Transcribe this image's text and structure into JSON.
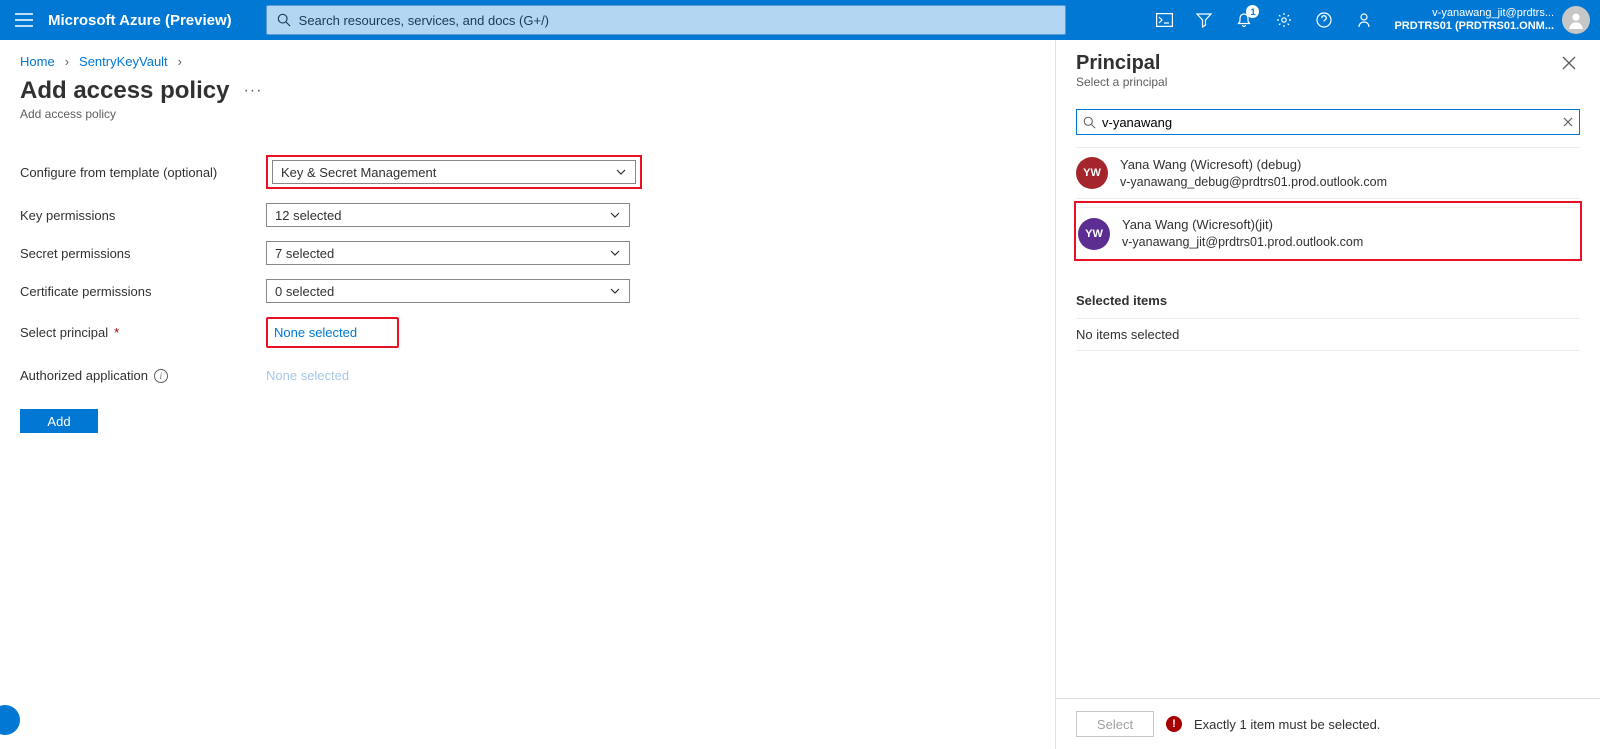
{
  "header": {
    "brand": "Microsoft Azure (Preview)",
    "search_placeholder": "Search resources, services, and docs (G+/)",
    "notifications_badge": "1",
    "user_line1": "v-yanawang_jit@prdtrs...",
    "user_line2": "PRDTRS01 (PRDTRS01.ONM..."
  },
  "breadcrumbs": {
    "home": "Home",
    "vault": "SentryKeyVault"
  },
  "page": {
    "title": "Add access policy",
    "subtitle": "Add access policy"
  },
  "form": {
    "template_label": "Configure from template (optional)",
    "template_value": "Key & Secret Management",
    "key_perm_label": "Key permissions",
    "key_perm_value": "12 selected",
    "secret_perm_label": "Secret permissions",
    "secret_perm_value": "7 selected",
    "cert_perm_label": "Certificate permissions",
    "cert_perm_value": "0 selected",
    "principal_label": "Select principal",
    "principal_value": "None selected",
    "auth_app_label": "Authorized application",
    "auth_app_value": "None selected",
    "add_button": "Add"
  },
  "panel": {
    "title": "Principal",
    "subtitle": "Select a principal",
    "search_value": "v-yanawang",
    "results": [
      {
        "initials": "YW",
        "name": "Yana Wang (Wicresoft) (debug)",
        "email": "v-yanawang_debug@prdtrs01.prod.outlook.com"
      },
      {
        "initials": "YW",
        "name": "Yana Wang (Wicresoft)(jit)",
        "email": "v-yanawang_jit@prdtrs01.prod.outlook.com"
      }
    ],
    "selected_heading": "Selected items",
    "no_items": "No items selected",
    "select_button": "Select",
    "error_text": "Exactly 1 item must be selected."
  }
}
